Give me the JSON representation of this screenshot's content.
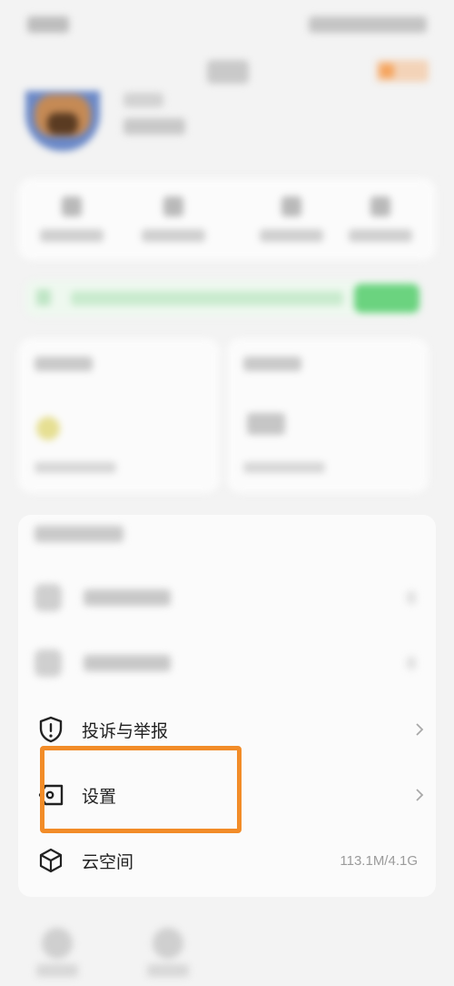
{
  "menu": {
    "items": [
      {
        "label": "投诉与举报",
        "icon": "shield-alert-icon"
      },
      {
        "label": "设置",
        "icon": "settings-tag-icon"
      },
      {
        "label": "云空间",
        "icon": "cube-icon",
        "value": "113.1M/4.1G"
      }
    ]
  },
  "highlight": {
    "target": "设置",
    "color": "#f28c28"
  }
}
